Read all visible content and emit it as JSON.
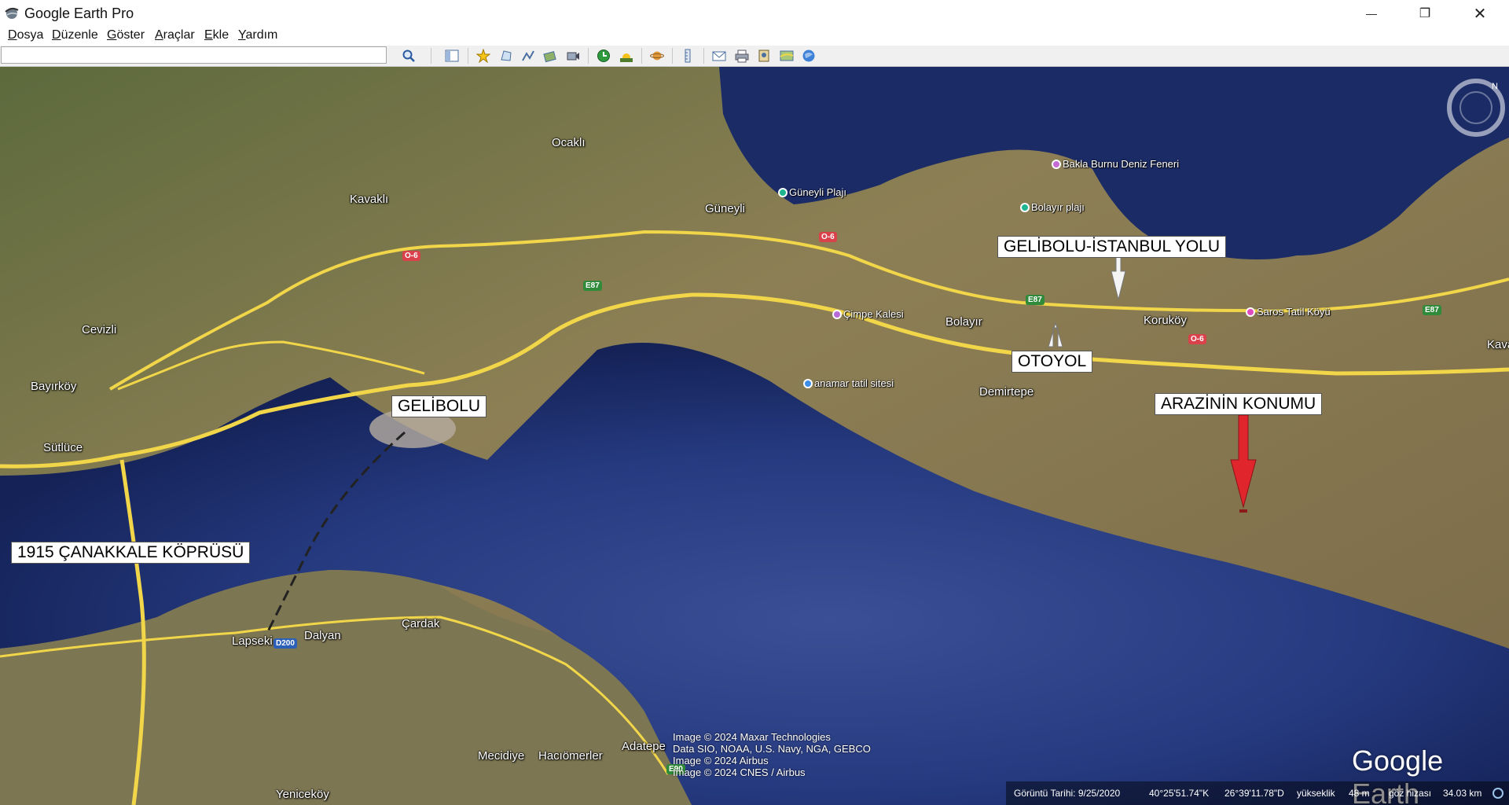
{
  "window": {
    "title": "Google Earth Pro",
    "min_glyph": "—",
    "max_glyph": "❐",
    "close_glyph": "✕"
  },
  "menu": {
    "items": [
      "Dosya",
      "Düzenle",
      "Göster",
      "Araçlar",
      "Ekle",
      "Yardım"
    ]
  },
  "toolbar": {
    "search_value": "",
    "search_placeholder": "",
    "buttons": [
      "search-icon",
      "sidebar-icon",
      "placemark-icon",
      "polygon-icon",
      "path-icon",
      "image-overlay-icon",
      "record-tour-icon",
      "historical-imagery-icon",
      "sunlight-icon",
      "planets-icon",
      "ruler-icon",
      "email-icon",
      "print-icon",
      "save-image-icon",
      "map-view-icon",
      "google-maps-icon"
    ]
  },
  "map": {
    "places": [
      "Ocaklı",
      "Kavaklı",
      "Güneyli",
      "Cevizli",
      "Bayırköy",
      "Sütlüce",
      "Bolayır",
      "Koruköy",
      "Demirtepe",
      "Dalyan",
      "Çardak",
      "Lapseki",
      "Mecidiye",
      "Hacıömerler",
      "Adatepe",
      "Yeniceköy",
      "Kava"
    ],
    "pois": [
      {
        "label": "Güneyli Plajı",
        "color": "#1fb58f"
      },
      {
        "label": "Bolayır plajı",
        "color": "#1fb58f"
      },
      {
        "label": "Bakla Burnu Deniz Feneri",
        "color": "#c66bd6"
      },
      {
        "label": "Çimpe Kalesi",
        "color": "#b76ad8"
      },
      {
        "label": "anamar tatil sitesi",
        "color": "#3c8ee8"
      },
      {
        "label": "Saros Tatil Köyü",
        "color": "#de4cc0"
      }
    ],
    "shields": [
      "O-6",
      "O-6",
      "O-6",
      "E87",
      "E87",
      "E87",
      "D200",
      "E90"
    ],
    "callouts": {
      "gelibolu": "GELİBOLU",
      "bridge": "1915 ÇANAKKALE KÖPRÜSÜ",
      "road": "GELİBOLU-İSTANBUL YOLU",
      "motorway": "OTOYOL",
      "land": "ARAZİNİN KONUMU"
    },
    "copyright": [
      "Image © 2024 Maxar Technologies",
      "Data SIO, NOAA, U.S. Navy, NGA, GEBCO",
      "Image © 2024 Airbus",
      "Image © 2024 CNES / Airbus"
    ],
    "logo": "Google Earth"
  },
  "status": {
    "imagery_date": "Görüntü Tarihi: 9/25/2020",
    "latitude": "40°25'51.74\"K",
    "longitude": "26°39'11.78\"D",
    "elevation_label": "yükseklik",
    "elevation": "48 m",
    "eye_alt_label": "göz hizası",
    "eye_alt": "34.03 km"
  },
  "colors": {
    "sea": "#22306e",
    "land": "#8a7d52",
    "road": "#f2d64a",
    "arrow": "#e0262c"
  }
}
